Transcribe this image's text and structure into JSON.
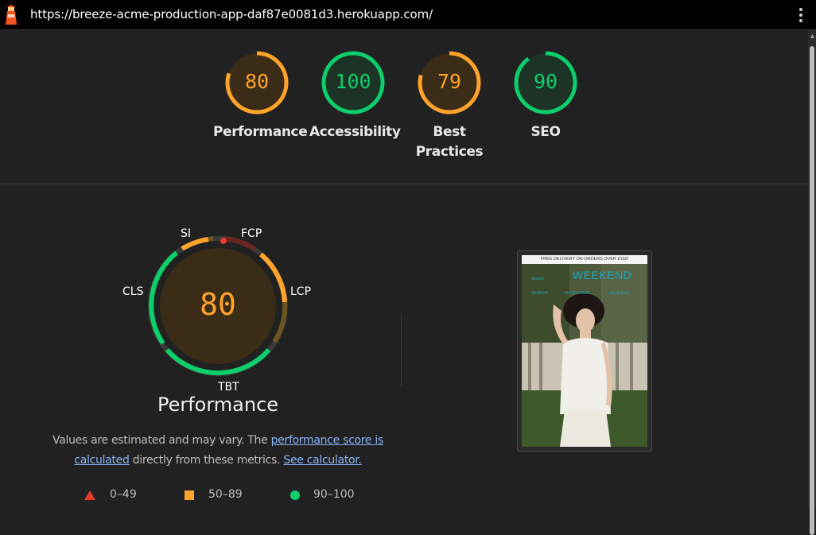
{
  "header": {
    "url": "https://breeze-acme-production-app-daf87e0081d3.herokuapp.com/",
    "logo_icon": "lighthouse-icon",
    "menu_icon": "vertical-dots-icon"
  },
  "category_scores": [
    {
      "label": "Performance",
      "score": 80,
      "rating": "average"
    },
    {
      "label": "Accessibility",
      "score": 100,
      "rating": "pass"
    },
    {
      "label_line1": "Best",
      "label_line2": "Practices",
      "score": 79,
      "rating": "average"
    },
    {
      "label": "SEO",
      "score": 90,
      "rating": "pass"
    }
  ],
  "performance": {
    "score": 80,
    "title": "Performance",
    "metrics": {
      "si": "SI",
      "fcp": "FCP",
      "lcp": "LCP",
      "tbt": "TBT",
      "cls": "CLS"
    },
    "description_prefix": "Values are estimated and may vary. The",
    "link_score": "performance score is calculated",
    "description_mid": "directly from these metrics.",
    "link_calculator": "See calculator."
  },
  "legend": [
    {
      "range": "0–49",
      "shape": "triangle",
      "color": "#e8392d"
    },
    {
      "range": "50–89",
      "shape": "square",
      "color": "#ffa32a"
    },
    {
      "range": "90–100",
      "shape": "circle",
      "color": "#0cce6b"
    }
  ],
  "colors": {
    "pass": "#0cce6b",
    "average": "#ffa32a",
    "fail": "#e8392d",
    "background": "#212121"
  },
  "screenshot": {
    "banner": "FREE DELIVERY ON ORDERS OVER £150!",
    "brand": "WEEKEND",
    "nav_left": "Search",
    "nav_items": [
      "SEARCH",
      "MY ACCOUNT",
      "£0.00 BAG"
    ]
  }
}
